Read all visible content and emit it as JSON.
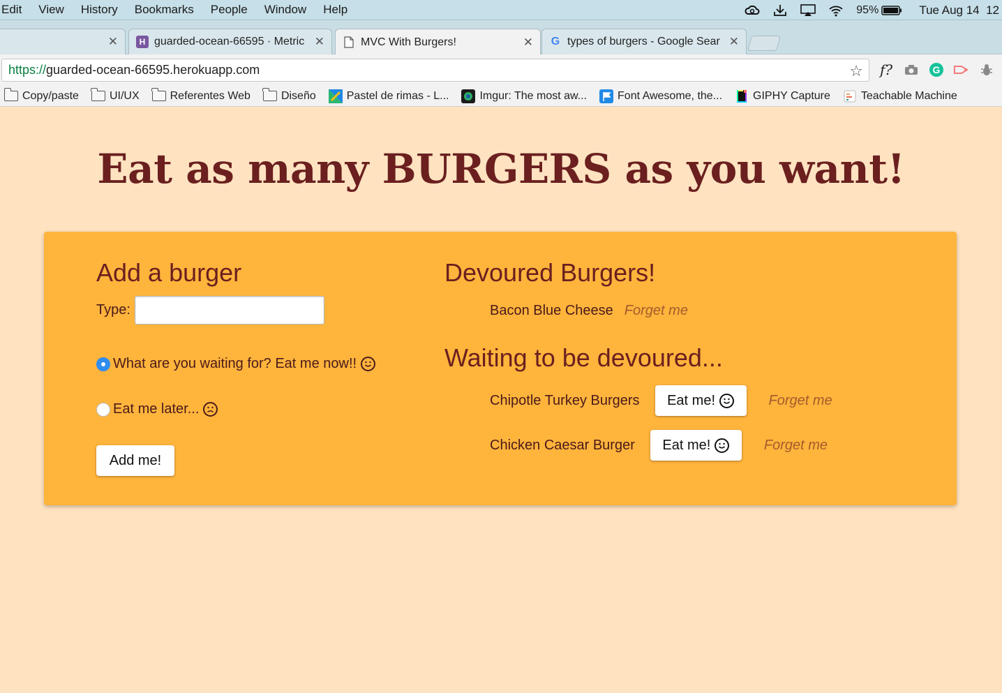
{
  "menubar": {
    "items": [
      "Edit",
      "View",
      "History",
      "Bookmarks",
      "People",
      "Window",
      "Help"
    ],
    "battery": "95%",
    "datetime": "Tue Aug 14  12"
  },
  "tabs": [
    {
      "title": "",
      "active": false
    },
    {
      "title": "guarded-ocean-66595 · Metric",
      "active": false
    },
    {
      "title": "MVC With Burgers!",
      "active": true
    },
    {
      "title": "types of burgers - Google Sear",
      "active": false
    }
  ],
  "address": {
    "scheme": "https://",
    "host": "guarded-ocean-66595.herokuapp.com"
  },
  "bookmarks": [
    {
      "label": "Copy/paste",
      "icon": "folder-icon"
    },
    {
      "label": "UI/UX",
      "icon": "folder-icon"
    },
    {
      "label": "Referentes Web",
      "icon": "folder-icon"
    },
    {
      "label": "Diseño",
      "icon": "folder-icon"
    },
    {
      "label": "Pastel de rimas - L...",
      "icon": "pastel-icon"
    },
    {
      "label": "Imgur: The most aw...",
      "icon": "imgur-icon"
    },
    {
      "label": "Font Awesome, the...",
      "icon": "fontawesome-icon"
    },
    {
      "label": "GIPHY Capture",
      "icon": "giphy-icon"
    },
    {
      "label": "Teachable Machine",
      "icon": "teachable-icon"
    }
  ],
  "page": {
    "title": "Eat as many BURGERS as you want!",
    "add": {
      "heading": "Add a burger",
      "type_label": "Type:",
      "type_value": "",
      "option_now": "What are you waiting for? Eat me now!!",
      "option_later": "Eat me later...",
      "submit": "Add me!"
    },
    "devoured": {
      "heading": "Devoured Burgers!",
      "items": [
        {
          "name": "Bacon Blue Cheese",
          "forget": "Forget me"
        }
      ]
    },
    "waiting": {
      "heading": "Waiting to be devoured...",
      "items": [
        {
          "name": "Chipotle Turkey Burgers",
          "eat": "Eat me!",
          "forget": "Forget me"
        },
        {
          "name": "Chicken Caesar Burger",
          "eat": "Eat me!",
          "forget": "Forget me"
        }
      ]
    }
  },
  "colors": {
    "background": "#ffe3c1",
    "card": "#ffb43c",
    "title": "#6b1f1f",
    "forget": "#a35c2c",
    "radio_checked": "#2f8cf0"
  }
}
